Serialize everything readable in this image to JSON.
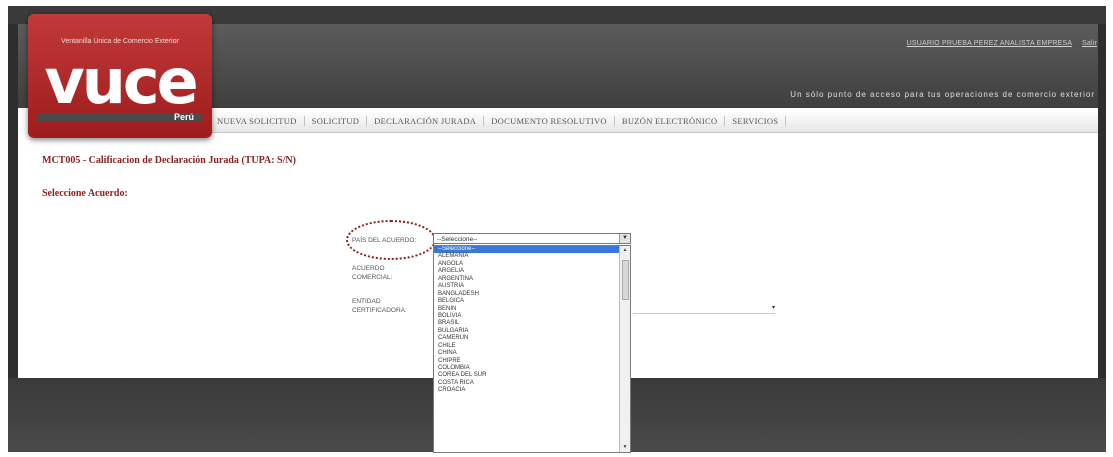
{
  "header": {
    "top_links": [
      "USUARIO PRUEBA PEREZ ANALISTA EMPRESA",
      "Salir"
    ],
    "tagline": "Un sólo punto de acceso para tus operaciones de comercio exterior"
  },
  "logo": {
    "top_text": "Ventanilla Única de Comercio Exterior",
    "word": "vuce",
    "country": "Perú"
  },
  "nav": {
    "items": [
      "NUEVA SOLICITUD",
      "SOLICITUD",
      "DECLARACIÓN JURADA",
      "DOCUMENTO RESOLUTIVO",
      "BUZÓN ELECTRÓNICO",
      "SERVICIOS"
    ]
  },
  "page": {
    "title": "MCT005 - Calificacion de Declaración Jurada (TUPA: S/N)",
    "section": "Seleccione Acuerdo:"
  },
  "form": {
    "pais_label": "PAÍS DEL ACUERDO:",
    "pais_value": "--Seleccione--",
    "acuerdo_label_1": "ACUERDO",
    "acuerdo_label_2": "COMERCIAL:",
    "entidad_label_1": "ENTIDAD",
    "entidad_label_2": "CERTIFICADORA:",
    "second_arrow": "▾"
  },
  "dropdown": {
    "options": [
      "--Seleccione--",
      "ALEMANIA",
      "ANGOLA",
      "ARGELIA",
      "ARGENTINA",
      "AUSTRIA",
      "BANGLADESH",
      "BELGICA",
      "BENIN",
      "BOLIVIA",
      "BRASIL",
      "BULGARIA",
      "CAMERUN",
      "CHILE",
      "CHINA",
      "CHIPRE",
      "COLOMBIA",
      "COREA DEL SUR",
      "COSTA RICA",
      "CROACIA"
    ],
    "selected_index": 0
  },
  "colors": {
    "brand_red": "#9e1c1c",
    "title_red": "#8a1f1f",
    "selection_blue": "#3a78d6"
  }
}
